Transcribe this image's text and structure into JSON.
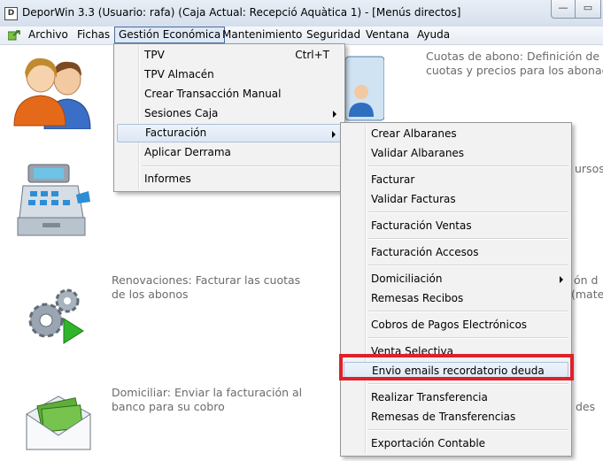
{
  "window": {
    "title": "DeporWin 3.3  (Usuario: rafa)  (Caja Actual: Recepció Aquàtica 1) - [Menús directos]",
    "icon_letter": "D",
    "minimize_glyph": "—",
    "maximize_glyph": "▭"
  },
  "menubar": {
    "items": [
      "Archivo",
      "Fichas",
      "Gestión Económica",
      "Mantenimiento",
      "Seguridad",
      "Ventana",
      "Ayuda"
    ],
    "active": "Gestión Económica"
  },
  "background_tiles": {
    "cuotas": [
      "Cuotas de abono: Definición de",
      "cuotas y precios para los abonac"
    ],
    "renovaciones": [
      "Renovaciones: Facturar las cuotas",
      "de los abonos"
    ],
    "domiciliar": [
      "Domiciliar: Enviar la facturación al",
      "banco para su cobro"
    ],
    "fragments": {
      "cursos": "ursos",
      "mate": "(mate",
      "on": "ón d",
      "des": "des"
    }
  },
  "gestion_menu": {
    "items": [
      {
        "label": "TPV",
        "shortcut": "Ctrl+T"
      },
      {
        "label": "TPV Almacén"
      },
      {
        "label": "Crear Transacción Manual"
      },
      {
        "label": "Sesiones Caja",
        "submenu": true
      },
      {
        "label": "Facturación",
        "submenu": true,
        "highlighted": true
      },
      {
        "label": "Aplicar Derrama"
      },
      {
        "label": "Informes"
      }
    ]
  },
  "facturacion_menu": {
    "items": [
      {
        "label": "Crear Albaranes"
      },
      {
        "label": "Validar Albaranes"
      },
      {
        "label": "Facturar"
      },
      {
        "label": "Validar Facturas"
      },
      {
        "label": "Facturación Ventas"
      },
      {
        "label": "Facturación Accesos"
      },
      {
        "label": "Domiciliación",
        "submenu": true
      },
      {
        "label": "Remesas Recibos"
      },
      {
        "label": "Cobros de Pagos Electrónicos"
      },
      {
        "label": "Venta Selectiva"
      },
      {
        "label": "Envio emails recordatorio deuda",
        "highlighted": true
      },
      {
        "label": "Realizar Transferencia"
      },
      {
        "label": "Remesas de Transferencias"
      },
      {
        "label": "Exportación Contable"
      }
    ]
  },
  "colors": {
    "annotation_box": "#e0202a",
    "menu_highlight": "#dce7f5"
  }
}
